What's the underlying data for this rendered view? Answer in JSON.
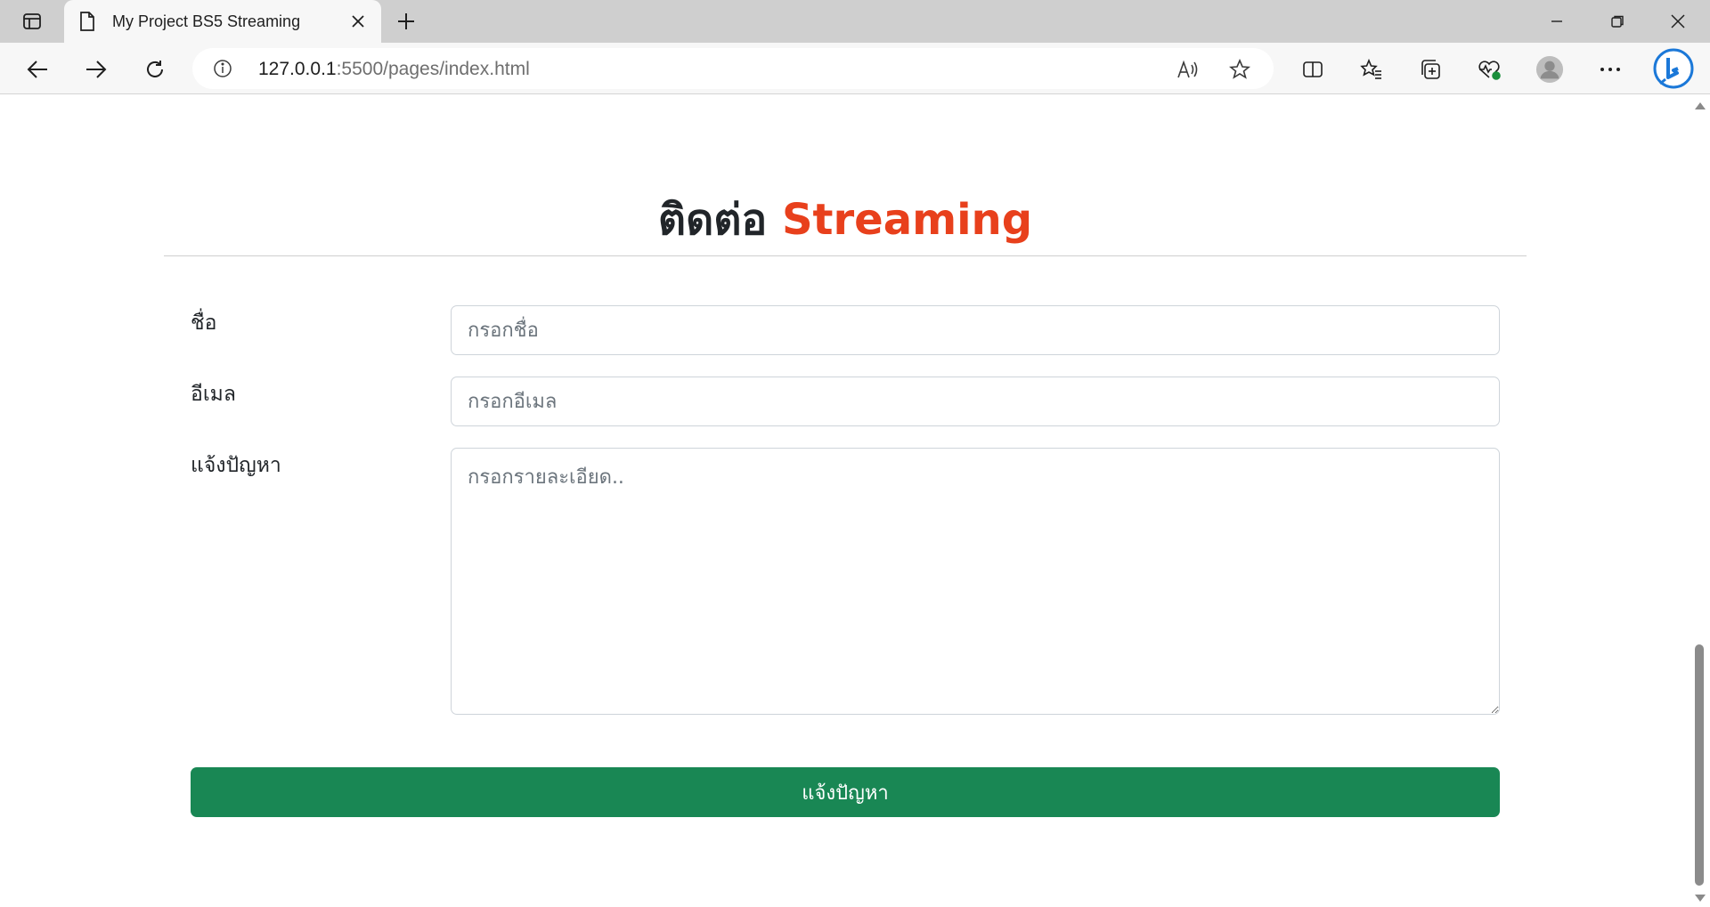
{
  "browser": {
    "tab_title": "My Project BS5 Streaming",
    "url_host": "127.0.0.1",
    "url_rest": ":5500/pages/index.html"
  },
  "page": {
    "heading_prefix": "ติดต่อ",
    "heading_accent": "Streaming",
    "accent_color": "#e8401c",
    "fields": {
      "name_label": "ชื่อ",
      "name_placeholder": "กรอกชื่อ",
      "email_label": "อีเมล",
      "email_placeholder": "กรอกอีเมล",
      "issue_label": "แจ้งปัญหา",
      "issue_placeholder": "กรอกรายละเอียด.."
    },
    "submit_label": "แจ้งปัญหา",
    "submit_color": "#198754"
  }
}
